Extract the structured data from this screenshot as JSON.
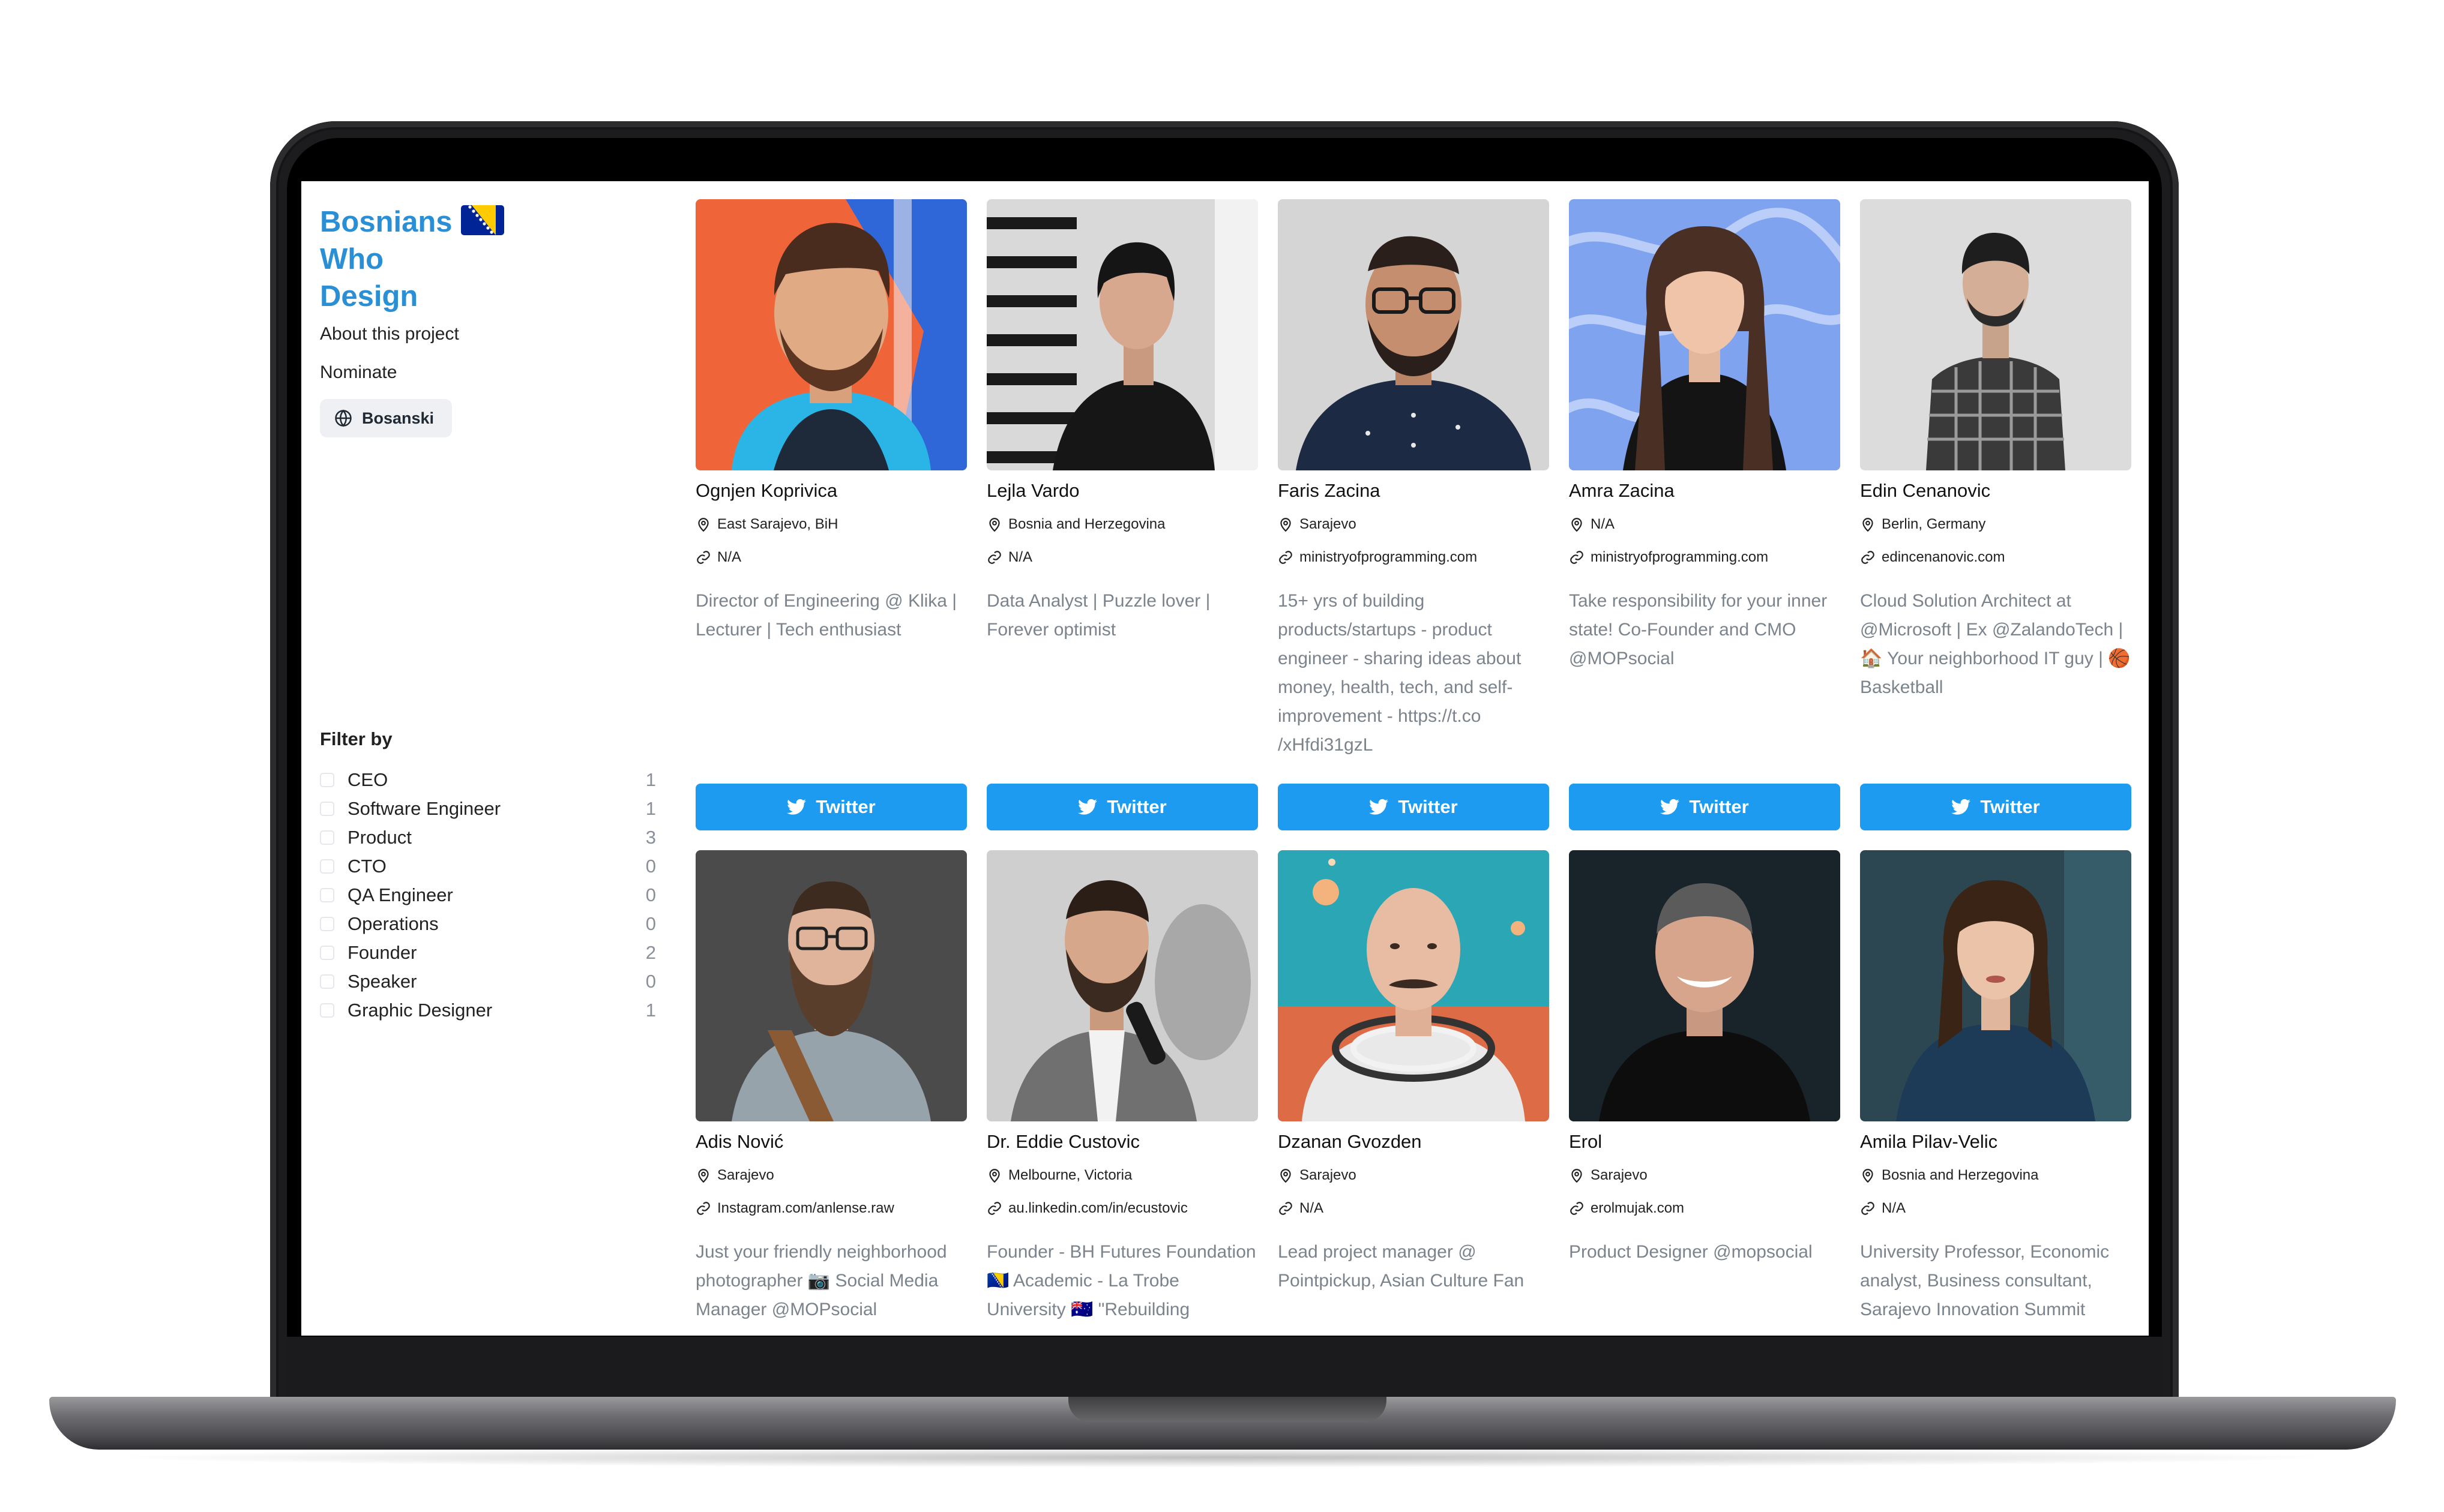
{
  "site": {
    "title_lines": [
      "Bosnians",
      "Who",
      "Design"
    ],
    "nav": {
      "about": "About this project",
      "nominate": "Nominate"
    },
    "language_button": "Bosanski"
  },
  "filters": {
    "title": "Filter by",
    "items": [
      {
        "label": "CEO",
        "count": "1"
      },
      {
        "label": "Software Engineer",
        "count": "1"
      },
      {
        "label": "Product",
        "count": "3"
      },
      {
        "label": "CTO",
        "count": "0"
      },
      {
        "label": "QA Engineer",
        "count": "0"
      },
      {
        "label": "Operations",
        "count": "0"
      },
      {
        "label": "Founder",
        "count": "2"
      },
      {
        "label": "Speaker",
        "count": "0"
      },
      {
        "label": "Graphic Designer",
        "count": "1"
      }
    ]
  },
  "people": [
    {
      "name": "Ognjen Koprivica",
      "location": "East Sarajevo, BiH",
      "website": "N/A",
      "bio": "Director of Engineering @ Klika | Lecturer | Tech enthusiast",
      "button": "Twitter"
    },
    {
      "name": "Lejla Vardo",
      "location": "Bosnia and Herzegovina",
      "website": "N/A",
      "bio": "Data Analyst | Puzzle lover | Forever optimist",
      "button": "Twitter"
    },
    {
      "name": "Faris Zacina",
      "location": "Sarajevo",
      "website": "ministryofprogramming.com",
      "bio": "15+ yrs of building products/startups - product engineer - sharing ideas about money, health, tech, and self-improvement - https://t.co /xHfdi31gzL",
      "button": "Twitter"
    },
    {
      "name": "Amra Zacina",
      "location": "N/A",
      "website": "ministryofprogramming.com",
      "bio": "Take responsibility for your inner state! Co-Founder and CMO @MOPsocial",
      "button": "Twitter"
    },
    {
      "name": "Edin Cenanovic",
      "location": "Berlin, Germany",
      "website": "edincenanovic.com",
      "bio": "Cloud Solution Architect at @Microsoft | Ex @ZalandoTech | 🏠 Your neighborhood IT guy | 🏀 Basketball",
      "button": "Twitter"
    },
    {
      "name": "Adis Nović",
      "location": "Sarajevo",
      "website": "Instagram.com/anlense.raw",
      "bio": "Just your friendly neighborhood photographer 📷 Social Media Manager @MOPsocial",
      "button": ""
    },
    {
      "name": "Dr. Eddie Custovic",
      "location": "Melbourne, Victoria",
      "website": "au.linkedin.com/in/ecustovic",
      "bio": "Founder - BH Futures Foundation 🇧🇦 Academic - La Trobe University 🇦🇺 \"Rebuilding",
      "button": ""
    },
    {
      "name": "Dzanan Gvozden",
      "location": "Sarajevo",
      "website": "N/A",
      "bio": "Lead project manager @ Pointpickup, Asian Culture Fan",
      "button": ""
    },
    {
      "name": "Erol",
      "location": "Sarajevo",
      "website": "erolmujak.com",
      "bio": "Product Designer @mopsocial",
      "button": ""
    },
    {
      "name": "Amila Pilav-Velic",
      "location": "Bosnia and Herzegovina",
      "website": "N/A",
      "bio": "University Professor, Economic analyst, Business consultant, Sarajevo Innovation Summit",
      "button": ""
    }
  ],
  "colors": {
    "brand": "#2b8fd6",
    "twitter": "#1d9bf0",
    "muted_text": "#7b838c"
  }
}
